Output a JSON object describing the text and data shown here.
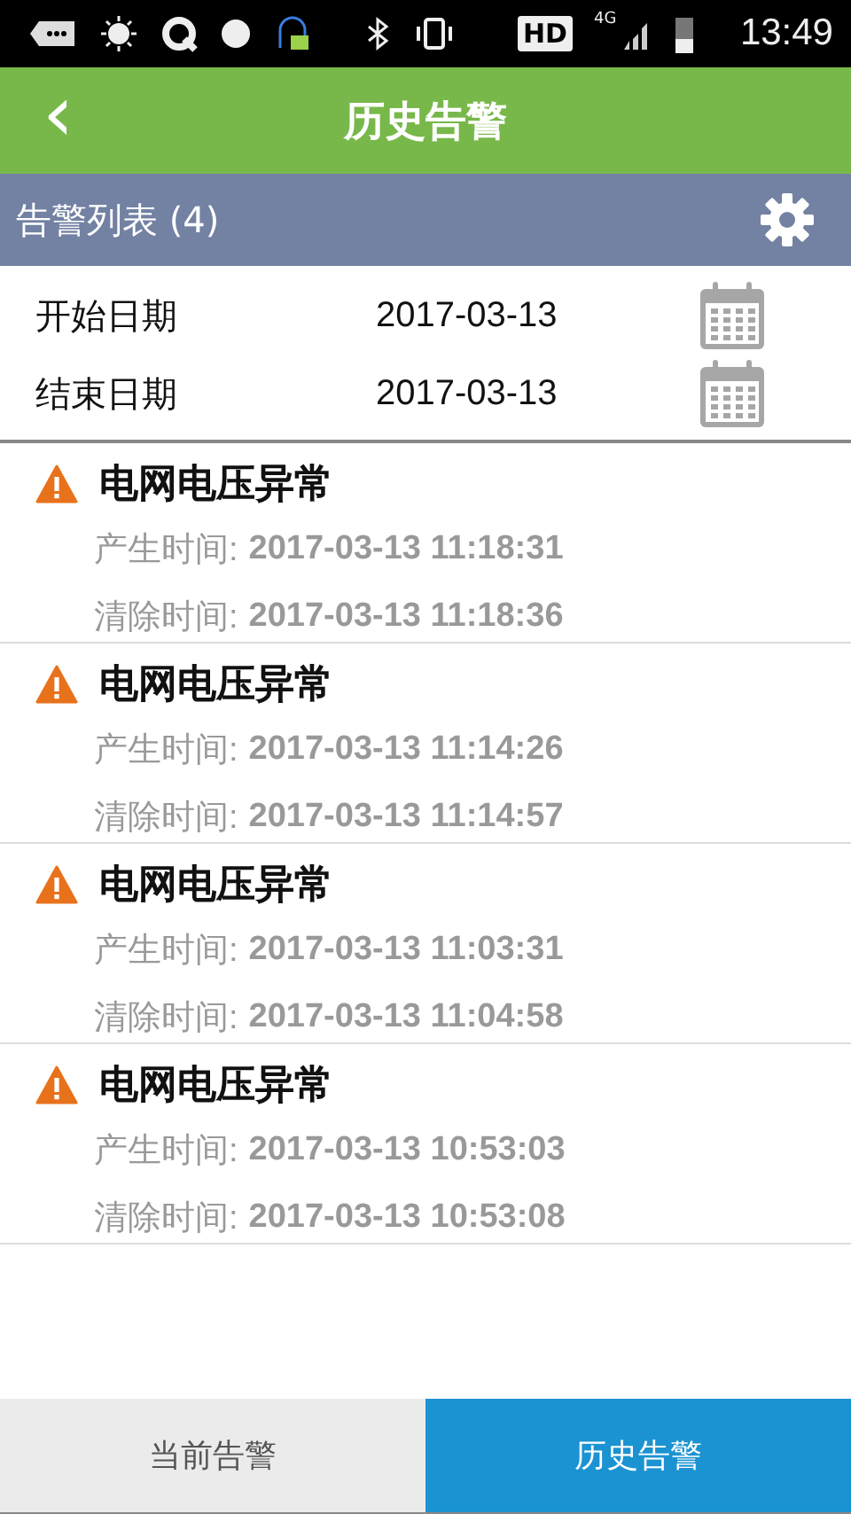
{
  "status_bar": {
    "hd": "HD",
    "network": "4G",
    "time": "13:49"
  },
  "header": {
    "back": "‹",
    "title": "历史告警"
  },
  "list_header": {
    "title": "告警列表 (4)"
  },
  "dates": [
    {
      "label": "开始日期",
      "value": "2017-03-13"
    },
    {
      "label": "结束日期",
      "value": "2017-03-13"
    }
  ],
  "alarms": [
    {
      "title": "电网电压异常",
      "created_label": "产生时间:",
      "created": "2017-03-13 11:18:31",
      "cleared_label": "清除时间:",
      "cleared": "2017-03-13 11:18:36"
    },
    {
      "title": "电网电压异常",
      "created_label": "产生时间:",
      "created": "2017-03-13 11:14:26",
      "cleared_label": "清除时间:",
      "cleared": "2017-03-13 11:14:57"
    },
    {
      "title": "电网电压异常",
      "created_label": "产生时间:",
      "created": "2017-03-13 11:03:31",
      "cleared_label": "清除时间:",
      "cleared": "2017-03-13 11:04:58"
    },
    {
      "title": "电网电压异常",
      "created_label": "产生时间:",
      "created": "2017-03-13 10:53:03",
      "cleared_label": "清除时间:",
      "cleared": "2017-03-13 10:53:08"
    }
  ],
  "tabs": [
    {
      "label": "当前告警",
      "selected": false
    },
    {
      "label": "历史告警",
      "selected": true
    }
  ]
}
